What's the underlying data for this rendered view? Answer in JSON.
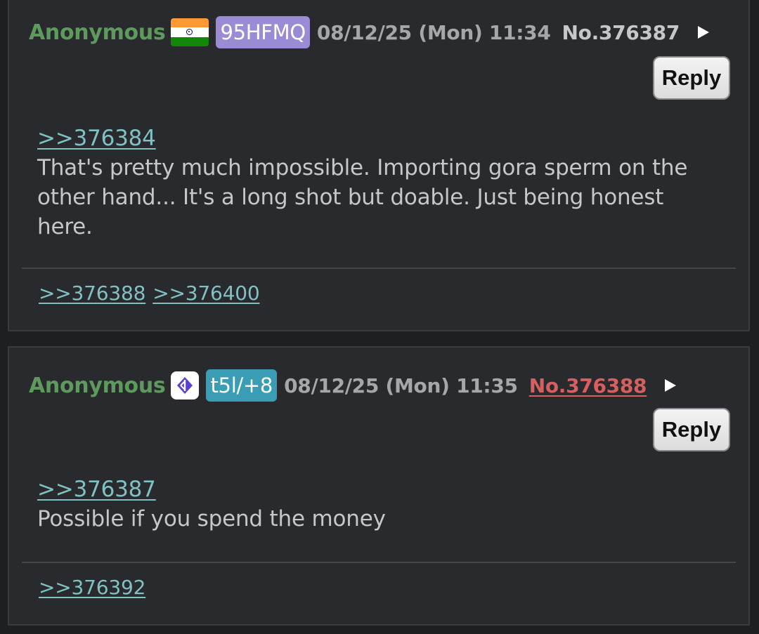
{
  "posts": [
    {
      "name": "Anonymous",
      "flag_icon": "india-flag-icon",
      "poster_id": "95HFMQ",
      "poster_id_color": "#9b8ad4",
      "datetime": "08/12/25 (Mon) 11:34",
      "post_number": "No.376387",
      "reply_label": "Reply",
      "quote": ">>376384",
      "lines": [
        "That's pretty much impossible. Importing gora sperm on the",
        "other hand... It's a long shot but doable. Just being honest",
        "here."
      ],
      "backlinks": [
        ">>376388",
        ">>376400"
      ]
    },
    {
      "name": "Anonymous",
      "flag_icon": "bluesky-butterfly-icon",
      "poster_id": "t5l/+8",
      "poster_id_color": "#3a9db5",
      "datetime": "08/12/25 (Mon) 11:35",
      "post_number": "No.376388",
      "reply_label": "Reply",
      "quote": ">>376387",
      "lines": [
        "Possible if you spend the money"
      ],
      "backlinks": [
        ">>376392"
      ]
    }
  ],
  "colors": {
    "background": "#1d1f21",
    "post_bg": "#282a2e",
    "name": "#5f9a5d",
    "text": "#c5c8c6",
    "quotelink": "#81c1c3",
    "highlighted_post_number": "#d75f5f"
  }
}
